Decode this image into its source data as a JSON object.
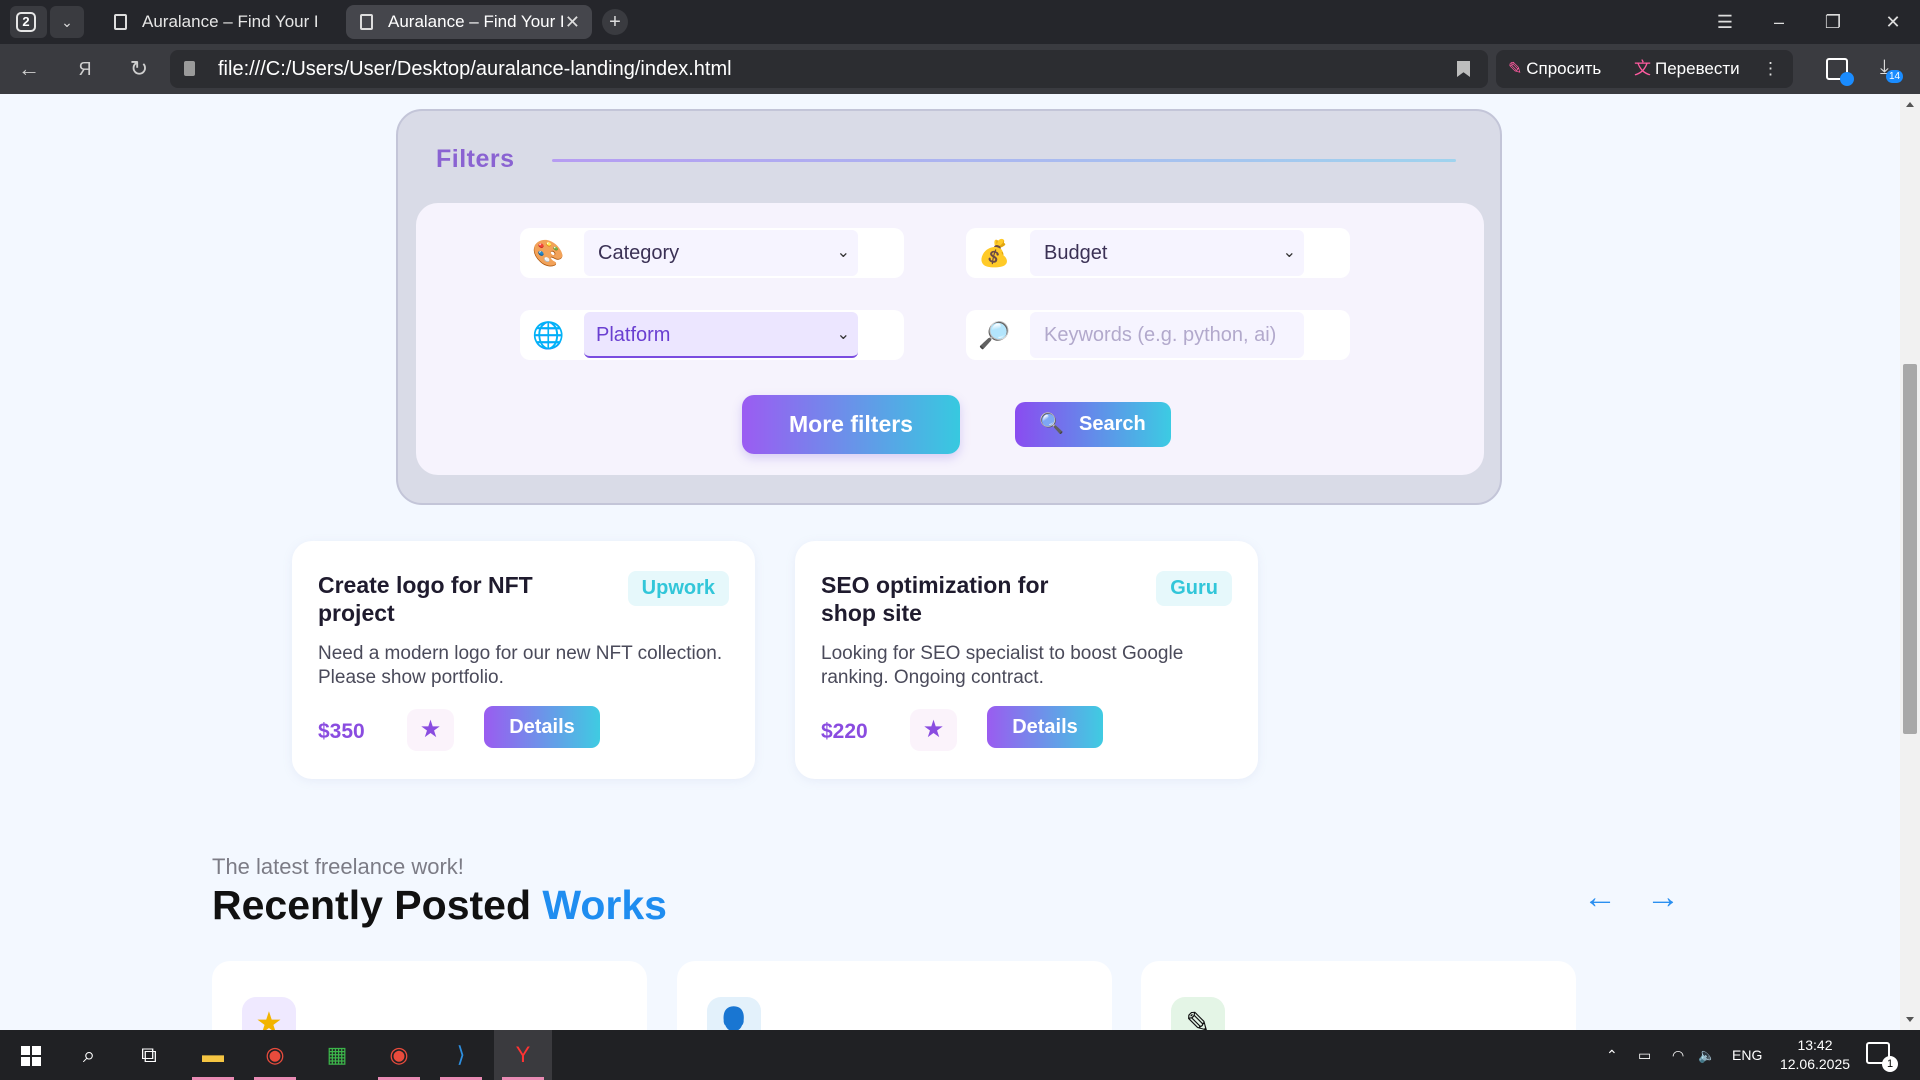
{
  "browser": {
    "tab_count": "2",
    "tabs": [
      {
        "title": "Auralance – Find Your Best"
      },
      {
        "title": "Auralance – Find Your Best"
      }
    ],
    "url": "file:///C:/Users/User/Desktop/auralance-landing/index.html",
    "assistant": {
      "ask_label": "Спросить",
      "translate_label": "Перевести"
    },
    "downloads_count": "14"
  },
  "filters": {
    "title": "Filters",
    "category_placeholder": "Category",
    "budget_placeholder": "Budget",
    "platform_placeholder": "Platform",
    "keywords_placeholder": "Keywords (e.g. python, ai)",
    "more_filters_label": "More filters",
    "search_label": "Search"
  },
  "jobs": [
    {
      "title": "Create logo for NFT project",
      "platform": "Upwork",
      "description": "Need a modern logo for our new NFT collection. Please show portfolio.",
      "price": "$350",
      "details_label": "Details"
    },
    {
      "title": "SEO optimization for shop site",
      "platform": "Guru",
      "description": "Looking for SEO specialist to boost Google ranking. Ongoing contract.",
      "price": "$220",
      "details_label": "Details"
    }
  ],
  "recent": {
    "subtitle": "The latest freelance work!",
    "title_main": "Recently Posted ",
    "title_accent": "Works",
    "prev_arrow": "←",
    "next_arrow": "→",
    "card_icons": [
      "star-icon",
      "person-icon",
      "pencil-icon"
    ]
  },
  "taskbar": {
    "language": "ENG",
    "time": "13:42",
    "date": "12.06.2025",
    "notifications": "1"
  },
  "colors": {
    "accent_purple": "#8a4ce0",
    "accent_cyan": "#32c6d9",
    "accent_blue": "#1f8df0",
    "page_bg": "#f3f8ff"
  }
}
